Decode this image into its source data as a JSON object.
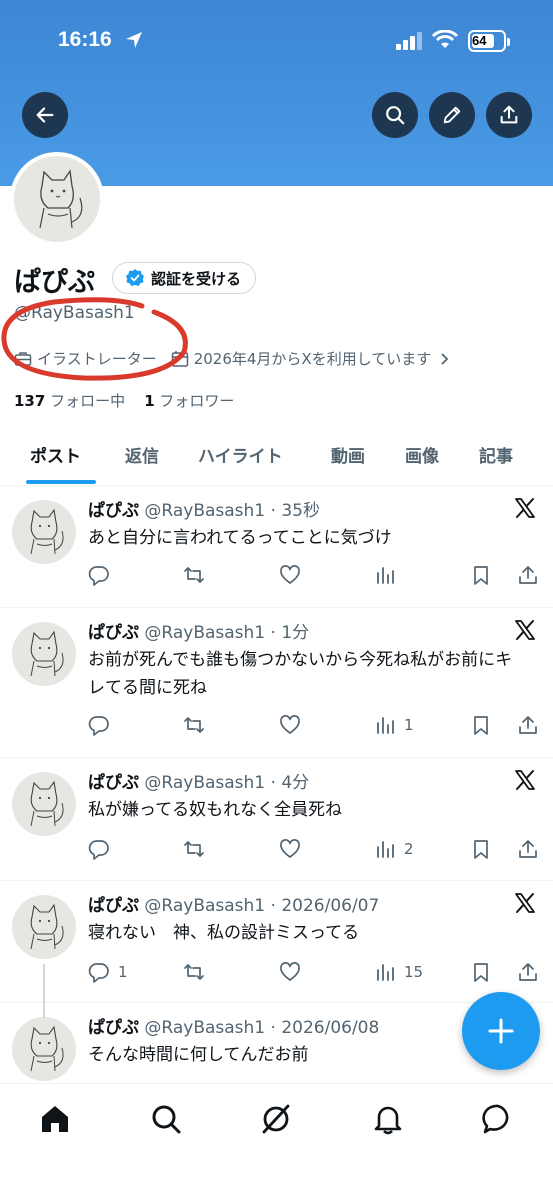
{
  "status_bar": {
    "time": "16:16",
    "battery": "64"
  },
  "profile": {
    "name": "ぱぴぷ",
    "verify_label": "認証を受ける",
    "handle": "@RayBasash1",
    "job": "イラストレーター",
    "joined": "2026年4月からXを利用しています",
    "following_count": "137",
    "following_label": "フォロー中",
    "followers_count": "1",
    "followers_label": "フォロワー"
  },
  "tabs": [
    "ポスト",
    "返信",
    "ハイライト",
    "動画",
    "画像",
    "記事"
  ],
  "posts": [
    {
      "name": "ぱぴぷ",
      "meta": "@RayBasash1 · 35秒",
      "text": "あと自分に言われてるってことに気づけ",
      "replies": "",
      "views": ""
    },
    {
      "name": "ぱぴぷ",
      "meta": "@RayBasash1 · 1分",
      "text": "お前が死んでも誰も傷つかないから今死ね私がお前にキレてる間に死ね",
      "replies": "",
      "views": "1"
    },
    {
      "name": "ぱぴぷ",
      "meta": "@RayBasash1 · 4分",
      "text": "私が嫌ってる奴もれなく全員死ね",
      "replies": "",
      "views": "2"
    },
    {
      "name": "ぱぴぷ",
      "meta": "@RayBasash1 · 2026/06/07",
      "text": "寝れない　神、私の設計ミスってる",
      "replies": "1",
      "views": "15"
    },
    {
      "name": "ぱぴぷ",
      "meta": "@RayBasash1 · 2026/06/08",
      "text": "そんな時間に何してんだお前"
    }
  ],
  "colors": {
    "banner": "#4a9be6",
    "accent": "#1d9bf0",
    "annotation": "#d93a2b"
  }
}
